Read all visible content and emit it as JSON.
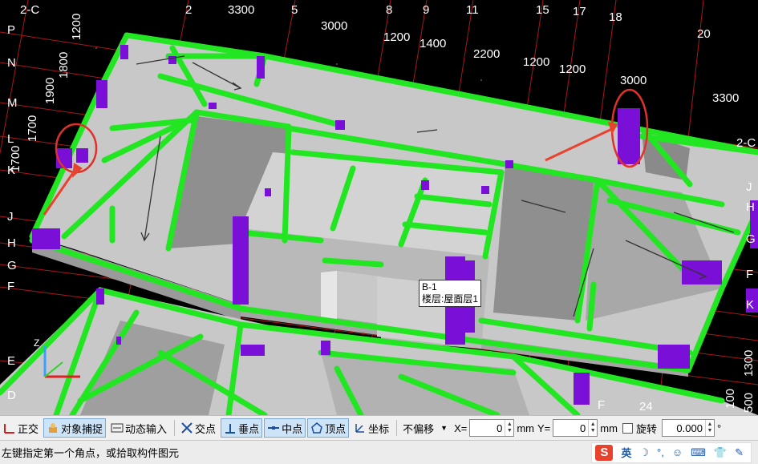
{
  "viewport": {
    "top_dimensions": [
      "2-C",
      "2",
      "3300",
      "5",
      "3000",
      "8",
      "9",
      "11",
      "15",
      "17",
      "18",
      "20",
      "1200",
      "1400",
      "2200",
      "1200",
      "1200",
      "3000",
      "3300"
    ],
    "left_axis_labels": [
      "P",
      "N",
      "M",
      "L",
      "K",
      "J",
      "H",
      "G",
      "F",
      "E",
      "D"
    ],
    "left_dimensions": [
      "1200",
      "1800",
      "1900",
      "1700",
      "1700"
    ],
    "right_axis_labels": [
      "2-C",
      "J",
      "H",
      "G",
      "F",
      "K"
    ],
    "right_dimensions": [
      "1300",
      "100",
      "500"
    ],
    "bottom_labels": [
      "F",
      "24"
    ],
    "axis_z_label": "Z",
    "tooltip": {
      "line1": "B-1",
      "line2": "楼层:屋面层1"
    }
  },
  "toolbar": {
    "ortho": "正交",
    "snap": "对象捕捉",
    "dynamic_input": "动态输入",
    "intersection": "交点",
    "perpendicular": "垂点",
    "midpoint": "中点",
    "vertex": "顶点",
    "coordinate": "坐标",
    "offset_mode": "不偏移",
    "x_label": "X=",
    "x_value": "0",
    "x_unit": "mm",
    "y_label": "Y=",
    "y_value": "0",
    "y_unit": "mm",
    "rotate_label": "旋转",
    "rotate_value": "0.000",
    "degree": "°"
  },
  "status": {
    "message": "左键指定第一个角点，或拾取构件图元",
    "ime_logo": "S",
    "ime_lang": "英"
  }
}
